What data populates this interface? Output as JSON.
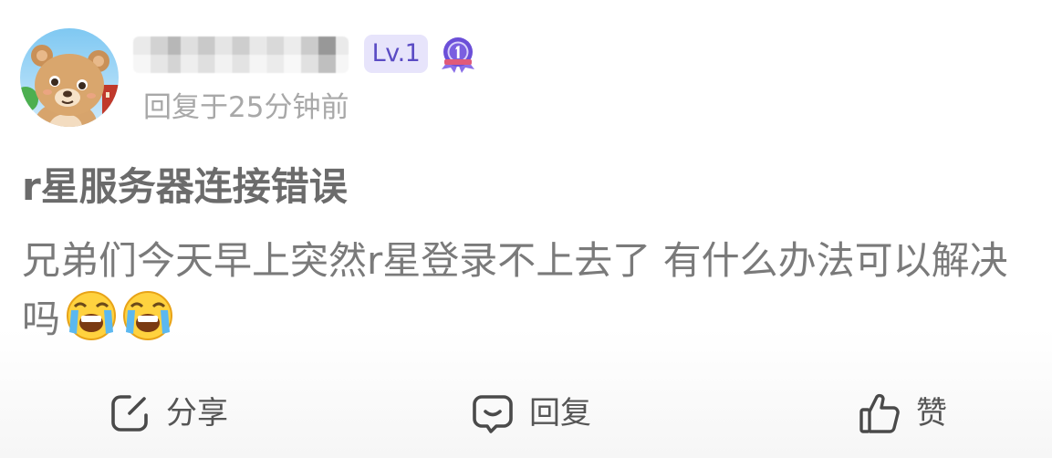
{
  "user": {
    "avatar_icon": "bear-avatar-icon",
    "level_badge": "Lv.1",
    "rank_icon": "rank-medal-icon",
    "reply_time": "回复于25分钟前"
  },
  "post": {
    "title": "r星服务器连接错误",
    "body": "兄弟们今天早上突然r星登录不上去了 有什么办法可以解决吗",
    "emojis": [
      "crying-face-icon",
      "crying-face-icon"
    ]
  },
  "actions": {
    "share_label": "分享",
    "share_icon": "share-edit-icon",
    "reply_label": "回复",
    "reply_icon": "comment-bubble-icon",
    "like_label": "赞",
    "like_icon": "thumbs-up-icon"
  },
  "colors": {
    "badge_bg": "#e7e4fb",
    "badge_text": "#5a4bc4",
    "rank_purple": "#6b4fd8",
    "muted_text": "#a8a8a8",
    "title_text": "#6b6b6b",
    "body_text": "#7a7a7a"
  }
}
